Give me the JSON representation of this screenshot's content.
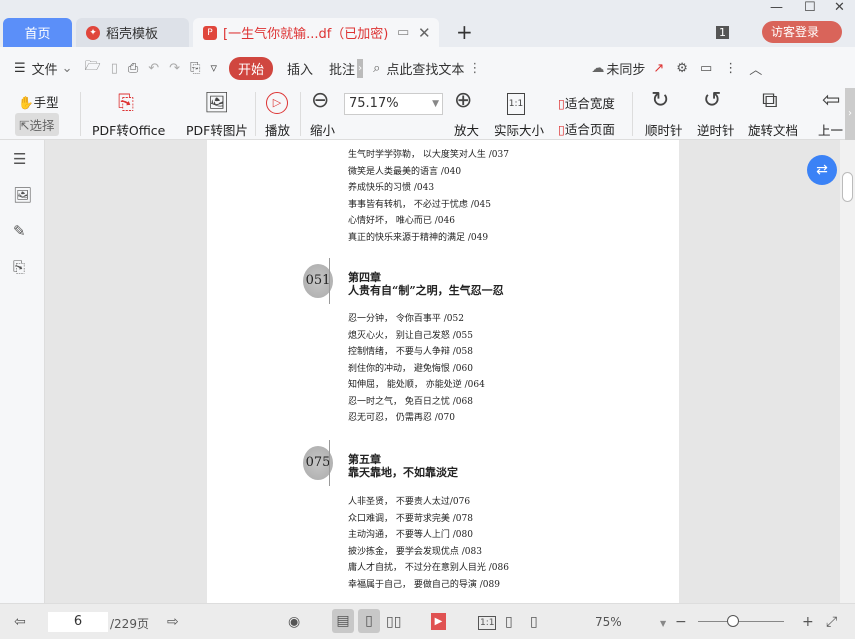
{
  "tabs": {
    "home": "首页",
    "template": "稻壳模板",
    "document": "[一生气你就输...df（已加密)",
    "new_tab": "+",
    "window_count": "1",
    "login": "访客登录"
  },
  "toolbar": {
    "file": "文件",
    "start": "开始",
    "insert": "插入",
    "annotate": "批注",
    "search_placeholder": "点此查找文本",
    "sync": "未同步"
  },
  "ribbon": {
    "hand": "手型",
    "select": "选择",
    "pdf_to_office": "PDF转Office",
    "pdf_to_image": "PDF转图片",
    "play": "播放",
    "zoom_out": "缩小",
    "zoom_value": "75.17%",
    "zoom_in": "放大",
    "actual_size": "实际大小",
    "fit_width": "适合宽度",
    "fit_page": "适合页面",
    "clockwise": "顺时针",
    "counterclockwise": "逆时针",
    "rotate_doc": "旋转文档",
    "prev": "上一"
  },
  "document": {
    "lines_top": [
      "生气时学学弥勒， 以大度笑对人生 /037",
      "微笑是人类最美的语言 /040",
      "养成快乐的习惯 /043",
      "事事皆有转机， 不必过于忧虑 /045",
      "心情好坏， 唯心而已 /046",
      "真正的快乐来源于精神的满足 /049"
    ],
    "chapter4": {
      "page": "051",
      "label": "第四章",
      "title": "人贵有自“制”之明，生气忍一忍",
      "items": [
        "忍一分钟， 令你百事平 /052",
        "熄灭心火， 别让自己发怒 /055",
        "控制情绪， 不要与人争辩 /058",
        "刹住你的冲动， 避免悔恨 /060",
        "知伸屈， 能处顺， 亦能处逆 /064",
        "忍一时之气， 免百日之忧 /068",
        "忍无可忍， 仍需再忍 /070"
      ]
    },
    "chapter5": {
      "page": "075",
      "label": "第五章",
      "title": "靠天靠地，不如靠淡定",
      "items": [
        "人非圣贤， 不要责人太过/076",
        "众口难调， 不要苛求完美 /078",
        "主动沟通， 不要等人上门 /080",
        "披沙拣金， 要学会发现优点 /083",
        "庸人才自扰， 不过分在意别人目光 /086",
        "幸福属于自己， 要做自己的导演 /089"
      ]
    }
  },
  "status": {
    "page": "6",
    "total": "/229页",
    "zoom": "75%"
  }
}
